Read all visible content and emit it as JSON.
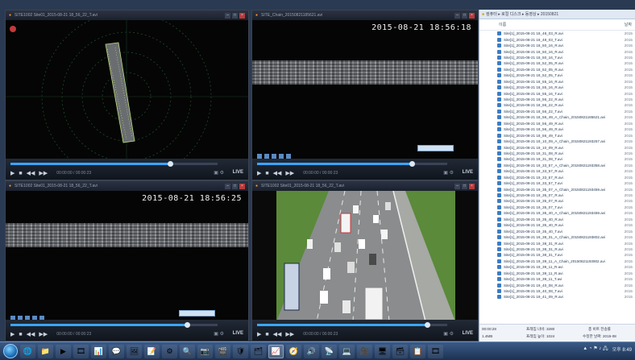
{
  "players": [
    {
      "id": "tl",
      "title": "SITE1002 Site01_2015-08-21 18_56_22_T.avi",
      "timestamp": "",
      "time_text": "00:00:00 / 00:00:23",
      "live": "LIVE",
      "progress": 0.78
    },
    {
      "id": "tr",
      "title": "SITE_Chain_20150821185621.avi",
      "timestamp": "2015-08-21 18:56:18",
      "time_text": "00:00:00 / 00:00:23",
      "live": "LIVE",
      "progress": 0.82
    },
    {
      "id": "bl",
      "title": "SITE1002 Site01_2015-08-21 18_56_22_T.avi",
      "timestamp": "2015-08-21 18:56:25",
      "time_text": "00:00:00 / 00:00:23",
      "live": "LIVE",
      "progress": 0.86
    },
    {
      "id": "br",
      "title": "SITE1002 Site01_2015-08-21 18_56_22_T.avi",
      "timestamp": "",
      "time_text": "00:00:00 / 00:00:23",
      "live": "LIVE",
      "progress": 0.9
    }
  ],
  "explorer": {
    "breadcrumb": "컴퓨터 ▸ 로컬 디스크 ▸ 동영상 ▸ 20150821",
    "header_name": "이름",
    "header_date": "날짜",
    "files": [
      {
        "name": "Site[1]_2015-08-21 18_48_03_R.avi",
        "date": "2015"
      },
      {
        "name": "Site[1]_2015-08-21 18_48_03_T.avi",
        "date": "2015"
      },
      {
        "name": "Site[1]_2015-08-21 18_50_16_R.avi",
        "date": "2015"
      },
      {
        "name": "Site[1]_2015-08-21 18_50_16_R.avi",
        "date": "2015"
      },
      {
        "name": "Site[1]_2015-08-21 18_50_16_T.avi",
        "date": "2015"
      },
      {
        "name": "Site[1]_2015-08-21 18_52_05_R.avi",
        "date": "2015"
      },
      {
        "name": "Site[1]_2015-08-21 18_52_05_R.avi",
        "date": "2015"
      },
      {
        "name": "Site[1]_2015-08-21 18_52_05_T.avi",
        "date": "2015"
      },
      {
        "name": "Site[1]_2015-08-21 18_55_16_R.avi",
        "date": "2015"
      },
      {
        "name": "Site[1]_2015-08-21 18_55_16_R.avi",
        "date": "2015"
      },
      {
        "name": "Site[1]_2015-08-21 18_55_16_T.avi",
        "date": "2015"
      },
      {
        "name": "Site[1]_2015-08-21 18_56_22_R.avi",
        "date": "2015"
      },
      {
        "name": "Site[1]_2015-08-21 18_56_22_R.avi",
        "date": "2015"
      },
      {
        "name": "Site[1]_2015-08-21 18_56_22_T.avi",
        "date": "2015"
      },
      {
        "name": "Site[1]_2015-08-21 18_56_49_A_Chain_20150821185621.avi",
        "date": "2015"
      },
      {
        "name": "Site[1]_2015-08-21 18_56_49_R.avi",
        "date": "2015"
      },
      {
        "name": "Site[1]_2015-08-21 18_56_49_R.avi",
        "date": "2015"
      },
      {
        "name": "Site[1]_2015-08-21 18_56_49_T.avi",
        "date": "2015"
      },
      {
        "name": "Site[1]_2015-08-21 19_10_09_A_Chain_20150821193257.avi",
        "date": "2015"
      },
      {
        "name": "Site[1]_2015-08-21 19_10_09_R.avi",
        "date": "2015"
      },
      {
        "name": "Site[1]_2015-08-21 19_31_08_R.avi",
        "date": "2015"
      },
      {
        "name": "Site[1]_2015-08-21 19_31_08_T.avi",
        "date": "2015"
      },
      {
        "name": "Site[1]_2015-08-21 19_33_57_A_Chain_20150821193358.avi",
        "date": "2015"
      },
      {
        "name": "Site[1]_2015-08-21 19_33_57_R.avi",
        "date": "2015"
      },
      {
        "name": "Site[1]_2015-08-21 19_33_57_R.avi",
        "date": "2015"
      },
      {
        "name": "Site[1]_2015-08-21 19_33_57_T.avi",
        "date": "2015"
      },
      {
        "name": "Site[1]_2015-08-21 19_35_07_A_Chain_20150821193459.avi",
        "date": "2015"
      },
      {
        "name": "Site[1]_2015-08-21 19_35_07_R.avi",
        "date": "2015"
      },
      {
        "name": "Site[1]_2015-08-21 19_35_07_R.avi",
        "date": "2015"
      },
      {
        "name": "Site[1]_2015-08-21 19_35_07_T.avi",
        "date": "2015"
      },
      {
        "name": "Site[1]_2015-08-21 19_35_40_A_Chain_20150821193459.avi",
        "date": "2015"
      },
      {
        "name": "Site[1]_2015-08-21 19_35_40_R.avi",
        "date": "2015"
      },
      {
        "name": "Site[1]_2015-08-21 19_35_40_R.avi",
        "date": "2015"
      },
      {
        "name": "Site[1]_2015-08-21 19_35_40_T.avi",
        "date": "2015"
      },
      {
        "name": "Site[1]_2015-08-21 19_38_31_A_Chain_20150821193802.avi",
        "date": "2015"
      },
      {
        "name": "Site[1]_2015-08-21 19_38_31_R.avi",
        "date": "2015"
      },
      {
        "name": "Site[1]_2015-08-21 19_38_31_R.avi",
        "date": "2015"
      },
      {
        "name": "Site[1]_2015-08-21 19_38_31_T.avi",
        "date": "2015"
      },
      {
        "name": "Site[1]_2015-08-21 19_39_11_A_Chain_20150821193902.avi",
        "date": "2015"
      },
      {
        "name": "Site[1]_2015-08-21 19_39_11_R.avi",
        "date": "2015"
      },
      {
        "name": "Site[1]_2015-08-21 19_39_11_R.avi",
        "date": "2015"
      },
      {
        "name": "Site[1]_2015-08-21 19_39_11_T.avi",
        "date": "2015"
      },
      {
        "name": "Site[1]_2015-08-21 19_40_08_R.avi",
        "date": "2015"
      },
      {
        "name": "Site[1]_2015-08-21 19_40_08_T.avi",
        "date": "2015"
      },
      {
        "name": "Site[1]_2015-08-21 19_41_09_R.avi",
        "date": "2015"
      }
    ],
    "status_left": "1.4MB",
    "status_left2": "00:00:28",
    "status_mid": "프레임 너비: 3280",
    "status_mid2": "프레임 높이: 1024",
    "status_right": "총 비트 전송률",
    "status_right2": "수정한 날짜: 2015-08"
  },
  "taskbar": {
    "apps": [
      "🌐",
      "📁",
      "▶",
      "🎞",
      "📊",
      "💬",
      "🖼",
      "📝",
      "⚙",
      "🔍",
      "📷",
      "🎬",
      "🛡",
      "🗂",
      "📈",
      "🧭",
      "🔊",
      "📡",
      "💻",
      "🎥",
      "🖥",
      "🗃",
      "📋",
      "🎞"
    ],
    "clock": "오후 8:49",
    "tray": "▲ ◔ ⚑ ♪ 🖧"
  },
  "colors": {
    "accent": "#3aa6ff",
    "title_logo": "#ff9a2a"
  }
}
